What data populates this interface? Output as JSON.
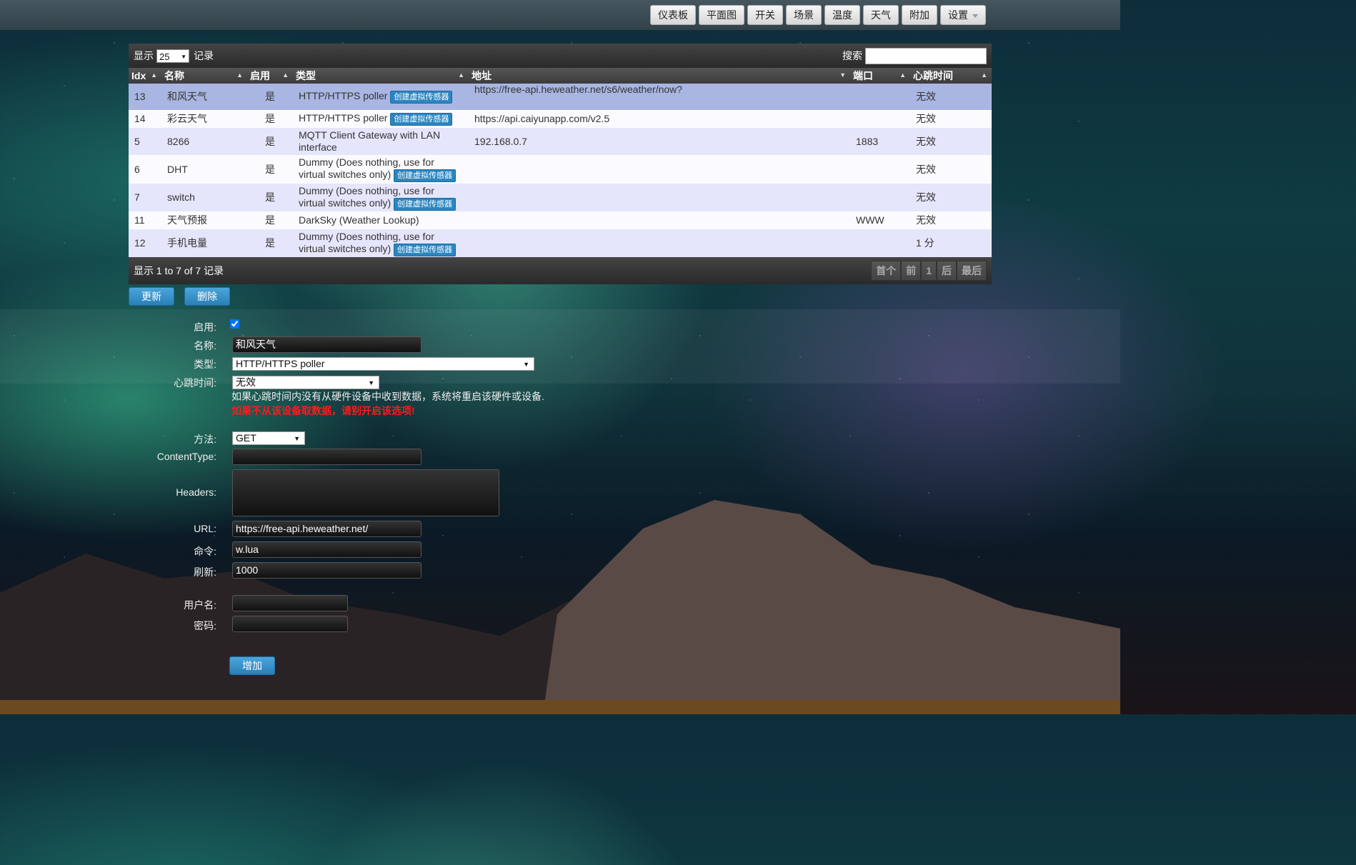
{
  "nav": {
    "items": [
      "仪表板",
      "平面图",
      "开关",
      "场景",
      "温度",
      "天气",
      "附加"
    ],
    "settings": "设置"
  },
  "table_controls": {
    "show_prefix": "显示",
    "page_size": "25",
    "show_suffix": "记录",
    "search_label": "搜索",
    "search_value": ""
  },
  "columns": [
    "Idx",
    "名称",
    "启用",
    "类型",
    "地址",
    "端口",
    "心跳时间"
  ],
  "virtual_sensor_label": "创建虚拟传感器",
  "rows": [
    {
      "idx": "13",
      "name": "和风天气",
      "enabled": "是",
      "type": "HTTP/HTTPS poller",
      "virtual": true,
      "address": "https://free-api.heweather.net/s6/weather/now?",
      "port": "",
      "timeout": "无效"
    },
    {
      "idx": "14",
      "name": "彩云天气",
      "enabled": "是",
      "type": "HTTP/HTTPS poller",
      "virtual": true,
      "address": "https://api.caiyunapp.com/v2.5",
      "port": "",
      "timeout": "无效"
    },
    {
      "idx": "5",
      "name": "8266",
      "enabled": "是",
      "type": "MQTT Client Gateway with LAN interface",
      "virtual": false,
      "address": "192.168.0.7",
      "port": "1883",
      "timeout": "无效"
    },
    {
      "idx": "6",
      "name": "DHT",
      "enabled": "是",
      "type": "Dummy (Does nothing, use for virtual switches only)",
      "virtual": true,
      "address": "",
      "port": "",
      "timeout": "无效"
    },
    {
      "idx": "7",
      "name": "switch",
      "enabled": "是",
      "type": "Dummy (Does nothing, use for virtual switches only)",
      "virtual": true,
      "address": "",
      "port": "",
      "timeout": "无效"
    },
    {
      "idx": "11",
      "name": "天气预报",
      "enabled": "是",
      "type": "DarkSky (Weather Lookup)",
      "virtual": false,
      "address": "",
      "port": "WWW",
      "timeout": "无效"
    },
    {
      "idx": "12",
      "name": "手机电量",
      "enabled": "是",
      "type": "Dummy (Does nothing, use for virtual switches only)",
      "virtual": true,
      "address": "",
      "port": "",
      "timeout": "1 分"
    }
  ],
  "footer": {
    "info": "显示 1 to 7 of 7 记录",
    "pager": [
      "首个",
      "前",
      "1",
      "后",
      "最后"
    ]
  },
  "actions": {
    "update": "更新",
    "delete": "删除"
  },
  "form": {
    "enabled_label": "启用:",
    "name_label": "名称:",
    "name_value": "和风天气",
    "type_label": "类型:",
    "type_value": "HTTP/HTTPS poller",
    "timeout_label": "心跳时间:",
    "timeout_value": "无效",
    "timeout_note": "如果心跳时间内没有从硬件设备中收到数据，系统将重启该硬件或设备.",
    "timeout_warning": "如果不从该设备取数据，请别开启该选项!",
    "method_label": "方法:",
    "method_value": "GET",
    "content_type_label": "ContentType:",
    "content_type_value": "",
    "headers_label": "Headers:",
    "headers_value": "",
    "url_label": "URL:",
    "url_value": "https://free-api.heweather.net/",
    "command_label": "命令:",
    "command_value": "w.lua",
    "refresh_label": "刷新:",
    "refresh_value": "1000",
    "username_label": "用户名:",
    "username_value": "",
    "password_label": "密码:",
    "password_value": "",
    "add_button": "增加"
  }
}
